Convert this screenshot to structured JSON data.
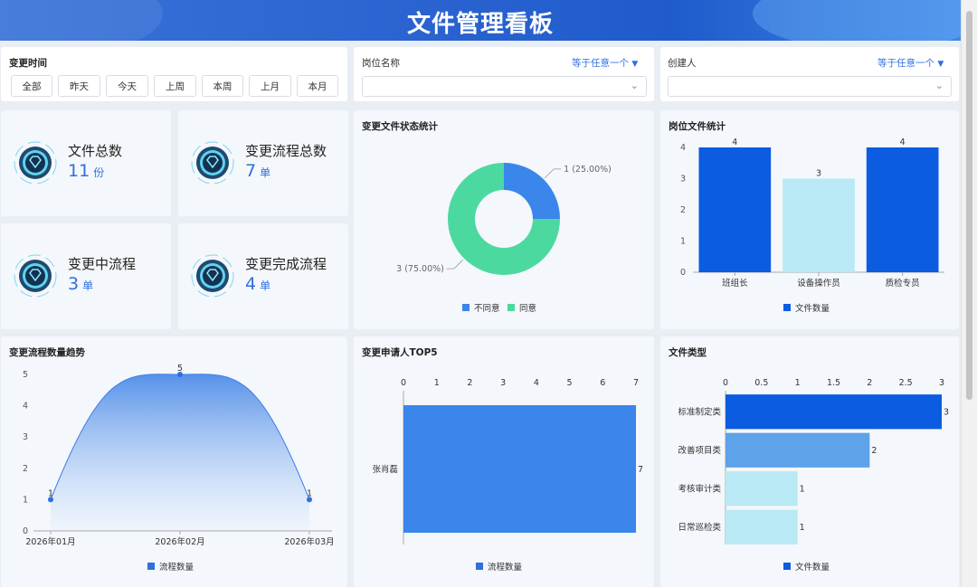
{
  "header": {
    "title": "文件管理看板"
  },
  "filters": {
    "change_time": {
      "label": "变更时间",
      "buttons": [
        "全部",
        "昨天",
        "今天",
        "上周",
        "本周",
        "上月",
        "本月"
      ]
    },
    "position": {
      "label": "岗位名称",
      "mode": "等于任意一个"
    },
    "creator": {
      "label": "创建人",
      "mode": "等于任意一个"
    }
  },
  "stats": [
    {
      "label": "文件总数",
      "value": "11",
      "unit": "份"
    },
    {
      "label": "变更流程总数",
      "value": "7",
      "unit": "单"
    },
    {
      "label": "变更中流程",
      "value": "3",
      "unit": "单"
    },
    {
      "label": "变更完成流程",
      "value": "4",
      "unit": "单"
    }
  ],
  "colors": {
    "accent": "#2f6fe0",
    "dark_blue": "#0b5ce0",
    "light_cyan": "#b8e9f5",
    "green": "#4cd9a0",
    "blue": "#3a86ea"
  },
  "chart_data": [
    {
      "id": "status",
      "type": "pie",
      "title": "变更文件状态统计",
      "categories": [
        "不同意",
        "同意"
      ],
      "values": [
        1,
        3
      ],
      "data_labels": [
        "1 (25.00%)",
        "3 (75.00%)"
      ],
      "legend": [
        "不同意",
        "同意"
      ],
      "colors": [
        "#3a86ea",
        "#4cd9a0"
      ],
      "legend_position": "bottom"
    },
    {
      "id": "position",
      "type": "bar",
      "title": "岗位文件统计",
      "categories": [
        "班组长",
        "设备操作员",
        "质检专员"
      ],
      "series": [
        {
          "name": "文件数量",
          "values": [
            4,
            3,
            4
          ]
        }
      ],
      "bar_colors": [
        "#0b5ce0",
        "#b8e9f5",
        "#0b5ce0"
      ],
      "y_ticks": [
        "0",
        "1",
        "2",
        "3",
        "4"
      ],
      "ylim": [
        0,
        4
      ],
      "legend_position": "bottom"
    },
    {
      "id": "trend",
      "type": "area",
      "title": "变更流程数量趋势",
      "categories": [
        "2026年01月",
        "2026年02月",
        "2026年03月"
      ],
      "series": [
        {
          "name": "流程数量",
          "values": [
            1,
            5,
            1
          ]
        }
      ],
      "y_ticks": [
        "0",
        "1",
        "2",
        "3",
        "4",
        "5"
      ],
      "ylim": [
        0,
        5
      ],
      "legend_position": "bottom"
    },
    {
      "id": "top5",
      "type": "bar",
      "orientation": "horizontal",
      "title": "变更申请人TOP5",
      "categories": [
        "张肖磊"
      ],
      "series": [
        {
          "name": "流程数量",
          "values": [
            7
          ]
        }
      ],
      "x_ticks": [
        "0",
        "1",
        "2",
        "3",
        "4",
        "5",
        "6",
        "7"
      ],
      "xlim": [
        0,
        7
      ],
      "legend_position": "bottom"
    },
    {
      "id": "filetype",
      "type": "bar",
      "orientation": "horizontal",
      "title": "文件类型",
      "categories": [
        "标准制定类",
        "改善项目类",
        "考核审计类",
        "日常巡检类"
      ],
      "series": [
        {
          "name": "文件数量",
          "values": [
            3,
            2,
            1,
            1
          ]
        }
      ],
      "bar_colors": [
        "#0b5ce0",
        "#5ea2ea",
        "#b8e9f5",
        "#b8e9f5"
      ],
      "x_ticks": [
        "0",
        "0.5",
        "1",
        "1.5",
        "2",
        "2.5",
        "3"
      ],
      "xlim": [
        0,
        3
      ],
      "legend_position": "bottom"
    }
  ]
}
